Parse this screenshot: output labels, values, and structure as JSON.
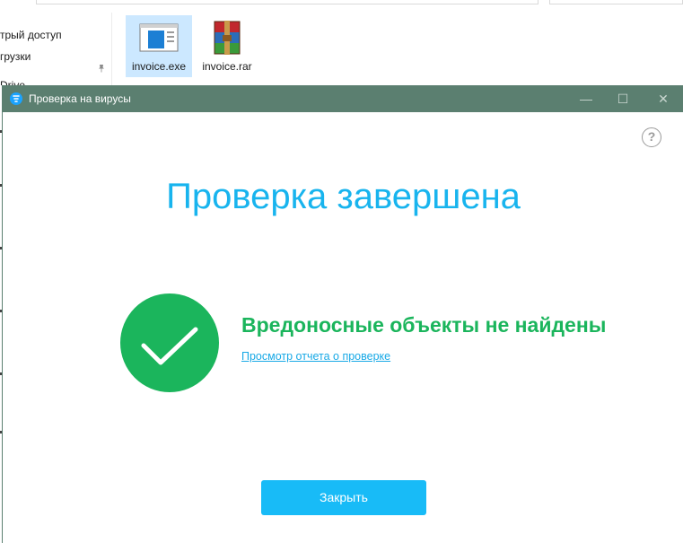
{
  "explorer": {
    "nav_items": [
      "трый доступ",
      "грузки",
      "Drive"
    ],
    "files": [
      {
        "name": "invoice.exe",
        "icon": "exe-file-icon",
        "selected": true
      },
      {
        "name": "invoice.rar",
        "icon": "winrar-archive-icon",
        "selected": false
      }
    ]
  },
  "dialog": {
    "title": "Проверка на вирусы",
    "app_icon": "shield-icon",
    "window_buttons": {
      "minimize": "—",
      "maximize": "☐",
      "close": "✕"
    },
    "help": "?",
    "headline": "Проверка завершена",
    "result": "Вредоносные объекты не найдены",
    "report_link": "Просмотр отчета о проверке",
    "close_button": "Закрыть"
  },
  "colors": {
    "titlebar": "#5b7f70",
    "headline": "#18b4ee",
    "success": "#1bb55c",
    "button": "#18bbf7"
  }
}
